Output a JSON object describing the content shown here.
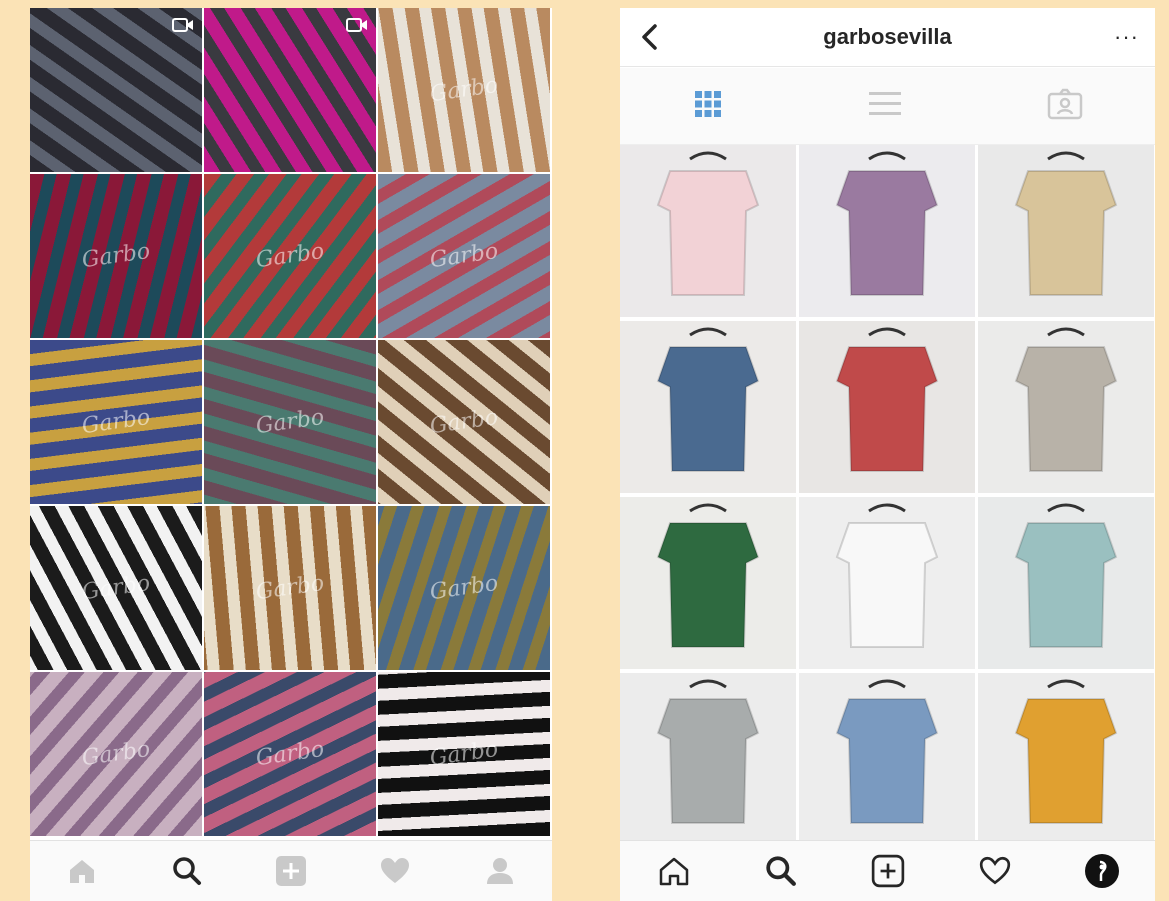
{
  "left_screen": {
    "watermark": "Garbo",
    "tiles": [
      {
        "name": "black-shoes-video",
        "c1": "#2a2a32",
        "c2": "#5c6270",
        "video": true
      },
      {
        "name": "pink-platform-sandal-video",
        "c1": "#c01a8a",
        "c2": "#3a3a40",
        "video": true
      },
      {
        "name": "woven-sandals",
        "c1": "#b98a60",
        "c2": "#e8e2d8",
        "video": false
      },
      {
        "name": "flared-trousers",
        "c1": "#8a1838",
        "c2": "#1d4a5a",
        "video": false
      },
      {
        "name": "embroidered-cushions",
        "c1": "#b33a3a",
        "c2": "#2f6a5e",
        "video": false
      },
      {
        "name": "striped-trousers-collage",
        "c1": "#7a8aa0",
        "c2": "#b04a5a",
        "video": false
      },
      {
        "name": "printed-scarves",
        "c1": "#3c4a8a",
        "c2": "#c8a040",
        "video": false
      },
      {
        "name": "striped-wide-pants",
        "c1": "#6a4a58",
        "c2": "#4a7a70",
        "video": false
      },
      {
        "name": "animal-print-espadrilles",
        "c1": "#6a4a30",
        "c2": "#e0d0b8",
        "video": false
      },
      {
        "name": "black-platform-sneakers",
        "c1": "#1b1b1b",
        "c2": "#f2f2f2",
        "video": false
      },
      {
        "name": "espadrille-collage",
        "c1": "#9a6a3a",
        "c2": "#e8ddc8",
        "video": false
      },
      {
        "name": "jumpsuits-with-bags",
        "c1": "#4a6a8a",
        "c2": "#8a7a3a",
        "video": false
      },
      {
        "name": "linen-dresses-bags",
        "c1": "#c8b0c0",
        "c2": "#8a6a8a",
        "video": false
      },
      {
        "name": "pink-print-tops",
        "c1": "#c06080",
        "c2": "#3a4a6a",
        "video": false
      },
      {
        "name": "white-top-black-frame",
        "c1": "#111111",
        "c2": "#f0eaea",
        "video": false
      }
    ]
  },
  "right_screen": {
    "username": "garbosevilla",
    "more_label": "···",
    "view_tabs": [
      {
        "name": "grid-view-tab",
        "icon": "grid-icon",
        "active": true
      },
      {
        "name": "list-view-tab",
        "icon": "list-icon",
        "active": false
      },
      {
        "name": "tagged-view-tab",
        "icon": "tagged-photo-icon",
        "active": false
      }
    ],
    "posts": [
      {
        "name": "pink-lace-up-sweater",
        "bg": "#ebe9ea",
        "fg": "#f2d2d6"
      },
      {
        "name": "lilac-cami-top",
        "bg": "#ecebee",
        "fg": "#9a7aa0"
      },
      {
        "name": "round-straw-bag",
        "bg": "#e9e9e9",
        "fg": "#d8c49a"
      },
      {
        "name": "denim-dungaree-dress",
        "bg": "#eceae8",
        "fg": "#4a6a90"
      },
      {
        "name": "embroidered-pouches",
        "bg": "#e8e6e4",
        "fg": "#c04a4a"
      },
      {
        "name": "striped-overalls",
        "bg": "#ebebea",
        "fg": "#b8b2a8"
      },
      {
        "name": "leaf-print-top",
        "bg": "#ecece9",
        "fg": "#2e6a40"
      },
      {
        "name": "white-sweater-red-stripes",
        "bg": "#eeeeee",
        "fg": "#f8f8f8"
      },
      {
        "name": "mint-print-shorts",
        "bg": "#e8eaea",
        "fg": "#9ac0c0"
      },
      {
        "name": "grey-bow-top",
        "bg": "#ececec",
        "fg": "#a8acac"
      },
      {
        "name": "flared-ripped-jeans",
        "bg": "#ededed",
        "fg": "#7a9ac0"
      },
      {
        "name": "mustard-crop-top",
        "bg": "#ececec",
        "fg": "#e0a030"
      }
    ]
  },
  "tab_bars": {
    "items": [
      "home-icon",
      "search-icon",
      "add-post-icon",
      "activity-heart-icon",
      "profile-icon"
    ],
    "active_left": "search-icon",
    "active_right": "profile-icon"
  },
  "colors": {
    "ig_text": "#262626",
    "inactive_icon": "#c9c9c9",
    "accent_grid": "#5b9bd5"
  }
}
